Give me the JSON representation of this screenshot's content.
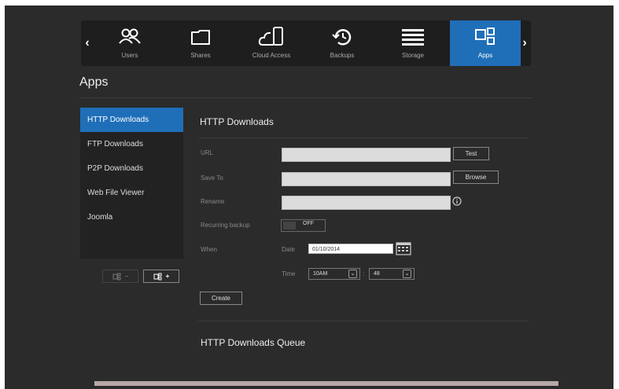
{
  "nav": {
    "items": [
      {
        "label": "Users",
        "icon": "users-icon"
      },
      {
        "label": "Shares",
        "icon": "folder-icon"
      },
      {
        "label": "Cloud Access",
        "icon": "cloud-device-icon"
      },
      {
        "label": "Backups",
        "icon": "history-icon"
      },
      {
        "label": "Storage",
        "icon": "storage-icon"
      },
      {
        "label": "Apps",
        "icon": "apps-icon"
      }
    ],
    "left_arrow": "‹",
    "right_arrow": "›"
  },
  "page_title": "Apps",
  "sidebar": {
    "items": [
      {
        "label": "HTTP Downloads"
      },
      {
        "label": "FTP Downloads"
      },
      {
        "label": "P2P Downloads"
      },
      {
        "label": "Web File Viewer"
      },
      {
        "label": "Joomla"
      }
    ],
    "remove_label": "−",
    "add_label": "+"
  },
  "main": {
    "title": "HTTP Downloads",
    "url_label": "URL",
    "url_value": "",
    "test_button": "Test",
    "save_to_label": "Save To",
    "save_to_value": "",
    "browse_button": "Browse",
    "rename_label": "Rename",
    "rename_value": "",
    "recurring_label": "Recurring backup",
    "toggle_state": "OFF",
    "when_label": "When",
    "date_label": "Date",
    "date_value": "01/10/2014",
    "time_label": "Time",
    "hour_value": "10AM",
    "minute_value": "48",
    "time_sep": ":",
    "create_button": "Create",
    "queue_title": "HTTP Downloads Queue"
  },
  "colors": {
    "accent": "#1f6fb8",
    "background": "#2b2b2b",
    "nav_bg": "#1e1e1e"
  }
}
